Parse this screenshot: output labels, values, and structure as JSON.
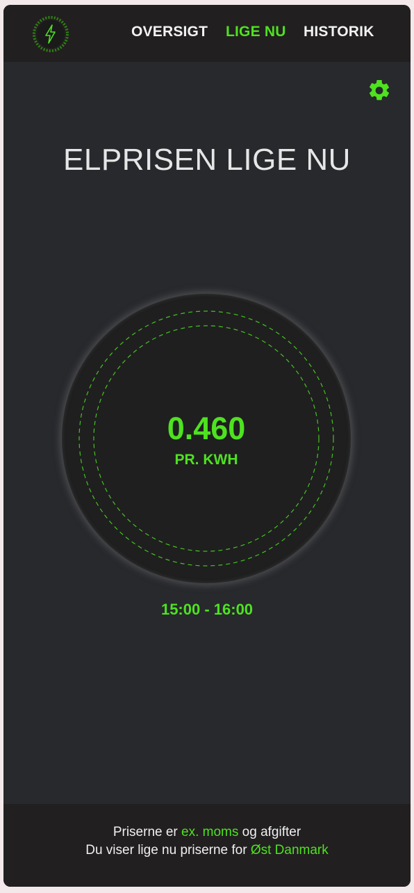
{
  "colors": {
    "accent": "#4ee21f",
    "background": "#27292d",
    "header": "#221f20"
  },
  "header": {
    "logo_icon": "lightning-bolt-icon",
    "nav": [
      {
        "label": "OVERSIGT",
        "active": false
      },
      {
        "label": "LIGE NU",
        "active": true
      },
      {
        "label": "HISTORIK",
        "active": false
      }
    ]
  },
  "settings_icon": "gear-icon",
  "main": {
    "title": "ELPRISEN LIGE NU",
    "price": "0.460",
    "unit": "PR. KWH",
    "time_range": "15:00 - 16:00"
  },
  "footer": {
    "line1_prefix": "Priserne er ",
    "line1_highlight": "ex. moms",
    "line1_suffix": " og afgifter",
    "line2_prefix": "Du viser lige nu priserne for ",
    "line2_highlight": "Øst Danmark"
  }
}
